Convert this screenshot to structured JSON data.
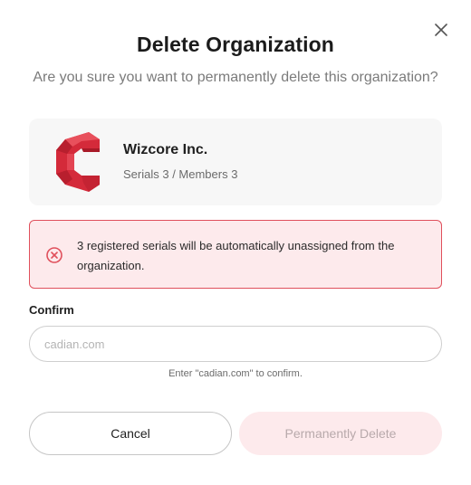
{
  "dialog": {
    "title": "Delete Organization",
    "subtitle": "Are you sure you want to permanently delete this organization?"
  },
  "organization": {
    "name": "Wizcore Inc.",
    "meta": "Serials 3 / Members 3",
    "logo_icon": "wizcore-logo-icon",
    "logo_color": "#d42a3a"
  },
  "warning": {
    "icon": "error-circle-icon",
    "text": "3 registered serials will be automatically unassigned from the organization.",
    "color": "#e0505c"
  },
  "confirm": {
    "label": "Confirm",
    "value": "",
    "placeholder": "cadian.com",
    "hint": "Enter \"cadian.com\" to confirm."
  },
  "actions": {
    "cancel_label": "Cancel",
    "delete_label": "Permanently Delete"
  }
}
